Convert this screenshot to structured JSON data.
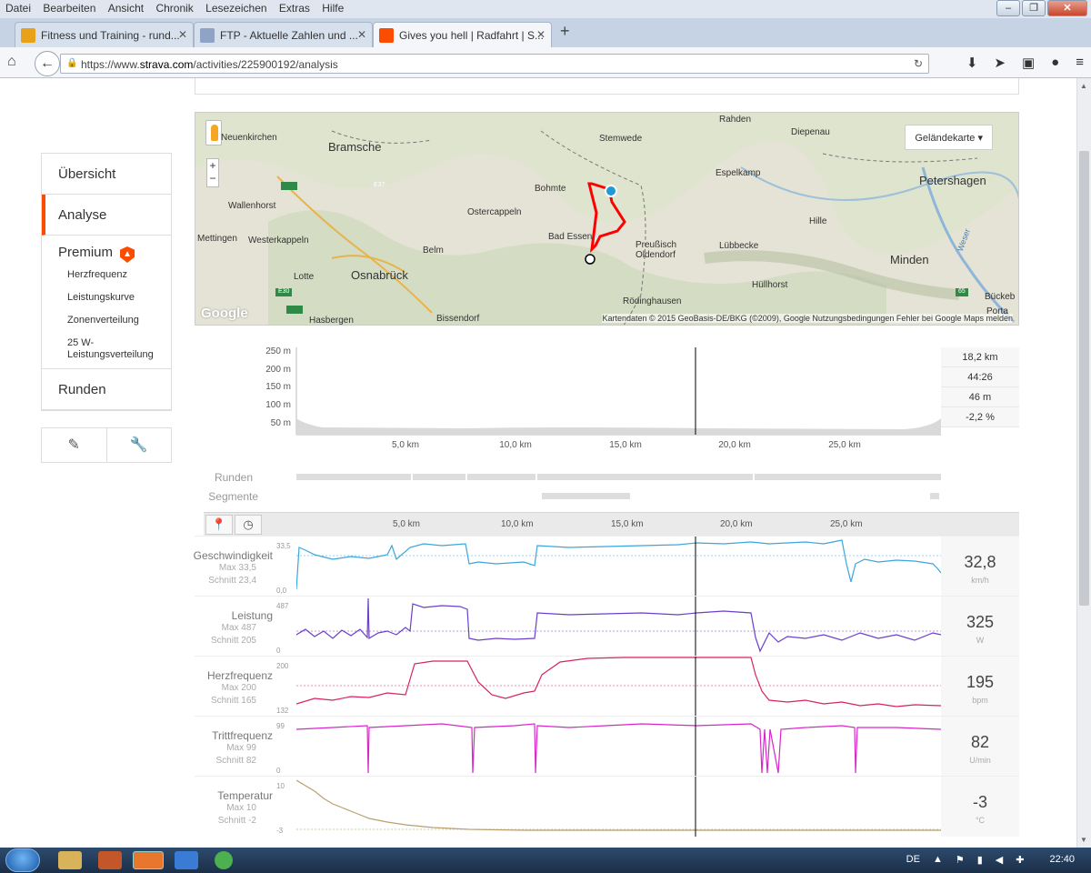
{
  "browser": {
    "menu": [
      "Datei",
      "Bearbeiten",
      "Ansicht",
      "Chronik",
      "Lesezeichen",
      "Extras",
      "Hilfe"
    ],
    "tabs": [
      {
        "title": "Fitness und Training - rund..."
      },
      {
        "title": "FTP - Aktuelle Zahlen und ..."
      },
      {
        "title": "Gives you hell | Radfahrt | S..."
      }
    ],
    "url_prefix": "https://www.",
    "url_domain": "strava.com",
    "url_path": "/activities/225900192/analysis"
  },
  "sidebar": {
    "items": [
      {
        "label": "Übersicht"
      },
      {
        "label": "Analyse"
      }
    ],
    "premium": "Premium",
    "sub": [
      "Herzfrequenz",
      "Leistungskurve",
      "Zonenverteilung"
    ],
    "sub2": "25 W-Leistungsverteilung",
    "runden": "Runden"
  },
  "map": {
    "maptype": "Geländekarte",
    "attribution": "Kartendaten © 2015 GeoBasis-DE/BKG (©2009), Google   Nutzungsbedingungen   Fehler bei Google Maps melden",
    "logo": "Google",
    "places": [
      "Rahden",
      "Stemwede",
      "Diepenau",
      "Neuenkirchen",
      "Bramsche",
      "Espelkamp",
      "Petershagen",
      "Bohmte",
      "Wallenhorst",
      "Ostercappeln",
      "Hille",
      "Mettingen",
      "Westerkappeln",
      "Bad Essen",
      "Preußisch Oldendorf",
      "Lübbecke",
      "Minden",
      "Belm",
      "Lotte",
      "Osnabrück",
      "Hüllhorst",
      "Rödinghausen",
      "Bückeb",
      "Hasbergen",
      "Bissendorf",
      "Porta",
      "Weser",
      "E37",
      "E30",
      "65"
    ]
  },
  "elevation": {
    "yticks": [
      "250 m",
      "200 m",
      "150 m",
      "100 m",
      "50 m"
    ],
    "xticks": [
      "5,0 km",
      "10,0 km",
      "15,0 km",
      "20,0 km",
      "25,0 km"
    ],
    "stats": [
      "18,2 km",
      "44:26",
      "46 m",
      "-2,2 %"
    ]
  },
  "laps": {
    "runden": "Runden",
    "segmente": "Segmente"
  },
  "streams": [
    {
      "name": "Geschwindigkeit",
      "max": "Max 33,5",
      "avg": "Schnitt 23,4",
      "hi": "33,5",
      "lo": "0,0",
      "value": "32,8",
      "unit": "km/h",
      "color": "#3aa6dd"
    },
    {
      "name": "Leistung",
      "max": "Max 487",
      "avg": "Schnitt 205",
      "hi": "487",
      "lo": "0",
      "value": "325",
      "unit": "W",
      "color": "#6b3fc9"
    },
    {
      "name": "Herzfrequenz",
      "max": "Max 200",
      "avg": "Schnitt 165",
      "hi": "200",
      "lo": "132",
      "value": "195",
      "unit": "bpm",
      "color": "#d6245a"
    },
    {
      "name": "Trittfrequenz",
      "max": "Max 99",
      "avg": "Schnitt 82",
      "hi": "99",
      "lo": "0",
      "value": "82",
      "unit": "U/min",
      "color": "#d627c9"
    },
    {
      "name": "Temperatur",
      "max": "Max 10",
      "avg": "Schnitt -2",
      "hi": "10",
      "lo": "-3",
      "value": "-3",
      "unit": "°C",
      "color": "#b8a070"
    }
  ],
  "taskbar": {
    "lang": "DE",
    "time": "22:40"
  }
}
